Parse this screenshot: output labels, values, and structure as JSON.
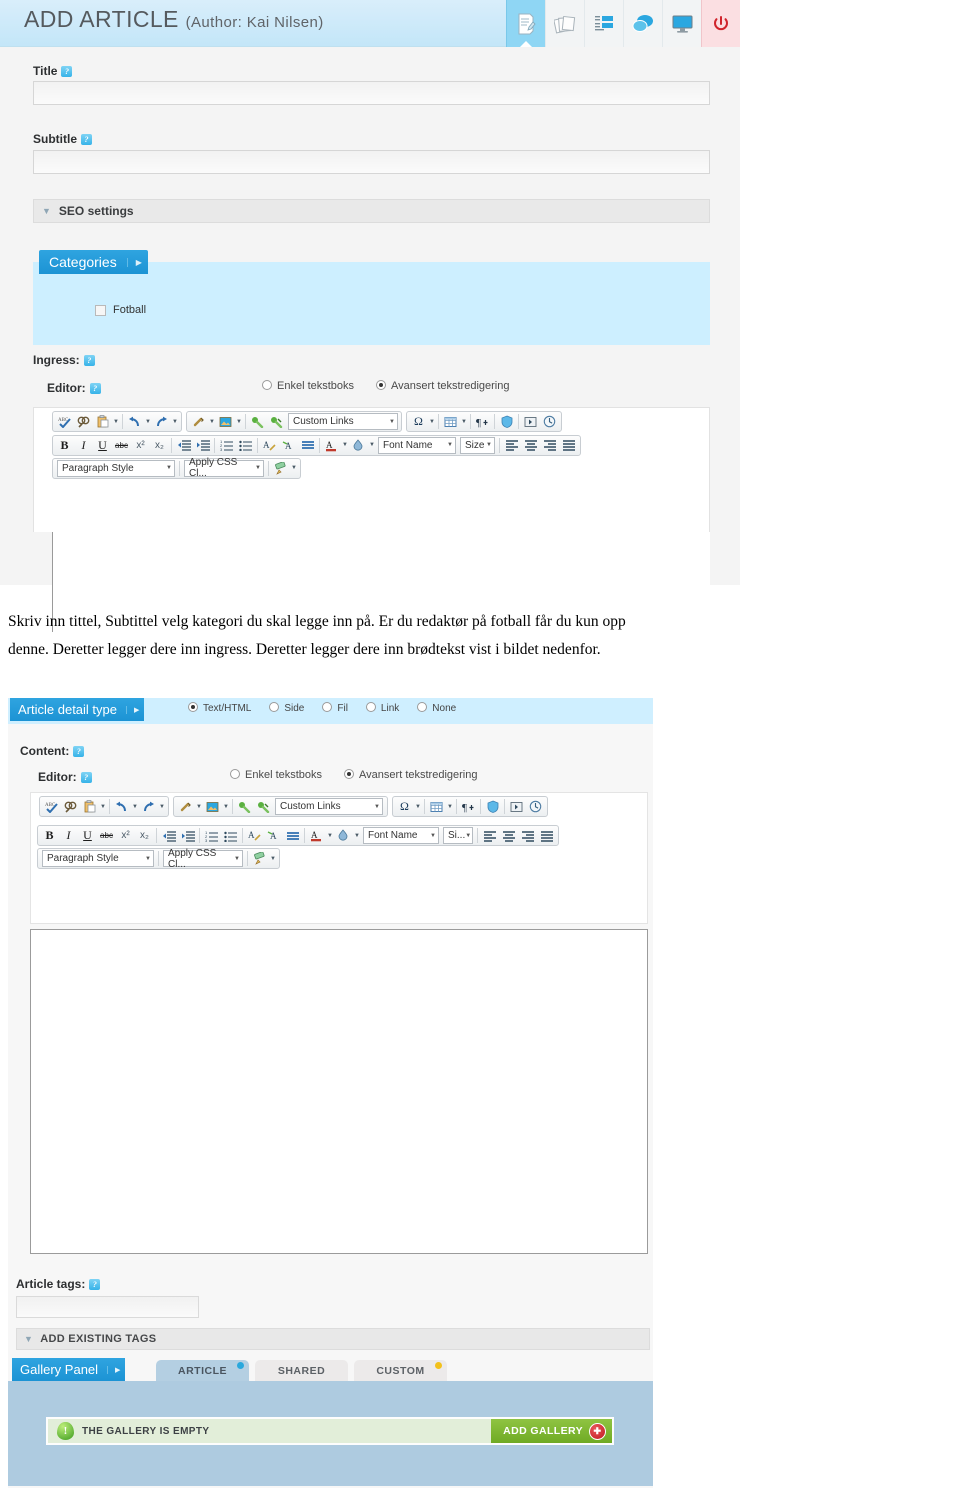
{
  "shot1": {
    "titlebar": {
      "title": "ADD ARTICLE",
      "author": "(Author: Kai Nilsen)",
      "icons": [
        {
          "name": "article-edit-icon",
          "glyph": "📝",
          "active": true
        },
        {
          "name": "pages-cards-icon",
          "glyph": "🗂",
          "active": false
        },
        {
          "name": "list-items-icon",
          "glyph": "☷",
          "active": false
        },
        {
          "name": "comments-icon",
          "glyph": "💬",
          "active": false
        },
        {
          "name": "preview-monitor-icon",
          "glyph": "🖵",
          "active": false
        },
        {
          "name": "power-logout-icon",
          "glyph": "⏻",
          "active": false
        }
      ]
    },
    "fields": {
      "title_label": "Title",
      "title_value": "",
      "subtitle_label": "Subtitle",
      "subtitle_value": "",
      "seo_label": "SEO settings"
    },
    "categories": {
      "tab_label": "Categories",
      "items": [
        {
          "label": "Fotball",
          "checked": false
        }
      ]
    },
    "ingress": {
      "label": "Ingress:",
      "editor_label": "Editor:",
      "radios": [
        {
          "label": "Enkel tekstboks",
          "selected": false
        },
        {
          "label": "Avansert tekstredigering",
          "selected": true
        }
      ]
    },
    "toolbar": {
      "row1": {
        "group1": [
          "spellcheck-icon",
          "find-icon",
          "paste-icon",
          "undo-icon",
          "redo-icon"
        ],
        "group2": [
          "link-icon",
          "image-icon",
          "anchor-icon",
          "unlink-icon"
        ],
        "custom_links": "Custom Links",
        "group3": [
          "special-char-icon",
          "table-icon",
          "pilcrow-icon",
          "shield-icon",
          "media-icon",
          "clock-icon"
        ]
      },
      "row2": {
        "bold": "B",
        "italic": "I",
        "underline": "U",
        "strike": "abc",
        "superscript": "x²",
        "subscript": "x₂",
        "font_name": "Font Name",
        "size": "Size"
      },
      "row3": {
        "paragraph_style": "Paragraph Style",
        "apply_css": "Apply CSS Cl...",
        "format_painter": "format-painter-icon"
      }
    }
  },
  "caption": {
    "line1": "Skriv inn tittel, Subtittel velg kategori du skal legge inn på. Er du redaktør på fotball får du kun opp",
    "line2": "denne.  Deretter legger dere inn ingress. Deretter legger dere inn brødtekst vist i bildet nedenfor."
  },
  "shot2": {
    "detail_type": {
      "tab_label": "Article detail type",
      "radios": [
        {
          "label": "Text/HTML",
          "selected": true
        },
        {
          "label": "Side",
          "selected": false
        },
        {
          "label": "Fil",
          "selected": false
        },
        {
          "label": "Link",
          "selected": false
        },
        {
          "label": "None",
          "selected": false
        }
      ]
    },
    "content": {
      "label": "Content:",
      "editor_label": "Editor:",
      "radios": [
        {
          "label": "Enkel tekstboks",
          "selected": false
        },
        {
          "label": "Avansert tekstredigering",
          "selected": true
        }
      ]
    },
    "toolbar": {
      "custom_links": "Custom Links",
      "font_name": "Font Name",
      "size": "Si...",
      "paragraph_style": "Paragraph Style",
      "apply_css": "Apply CSS Cl..."
    },
    "tags": {
      "label": "Article tags:",
      "value": "",
      "add_existing": "ADD EXISTING TAGS"
    },
    "gallery": {
      "panel_label": "Gallery Panel",
      "tabs": [
        {
          "label": "ARTICLE",
          "active": true,
          "dot": "#29a8dd"
        },
        {
          "label": "SHARED",
          "active": false,
          "dot": ""
        },
        {
          "label": "CUSTOM",
          "active": false,
          "dot": "#f2c11b"
        }
      ],
      "empty_text": "THE GALLERY IS EMPTY",
      "add_button": "ADD GALLERY"
    }
  },
  "colors": {
    "accent_blue": "#1c93d4",
    "panel_blue": "#cdefff",
    "green": "#6faa24",
    "red": "#c01b22"
  }
}
